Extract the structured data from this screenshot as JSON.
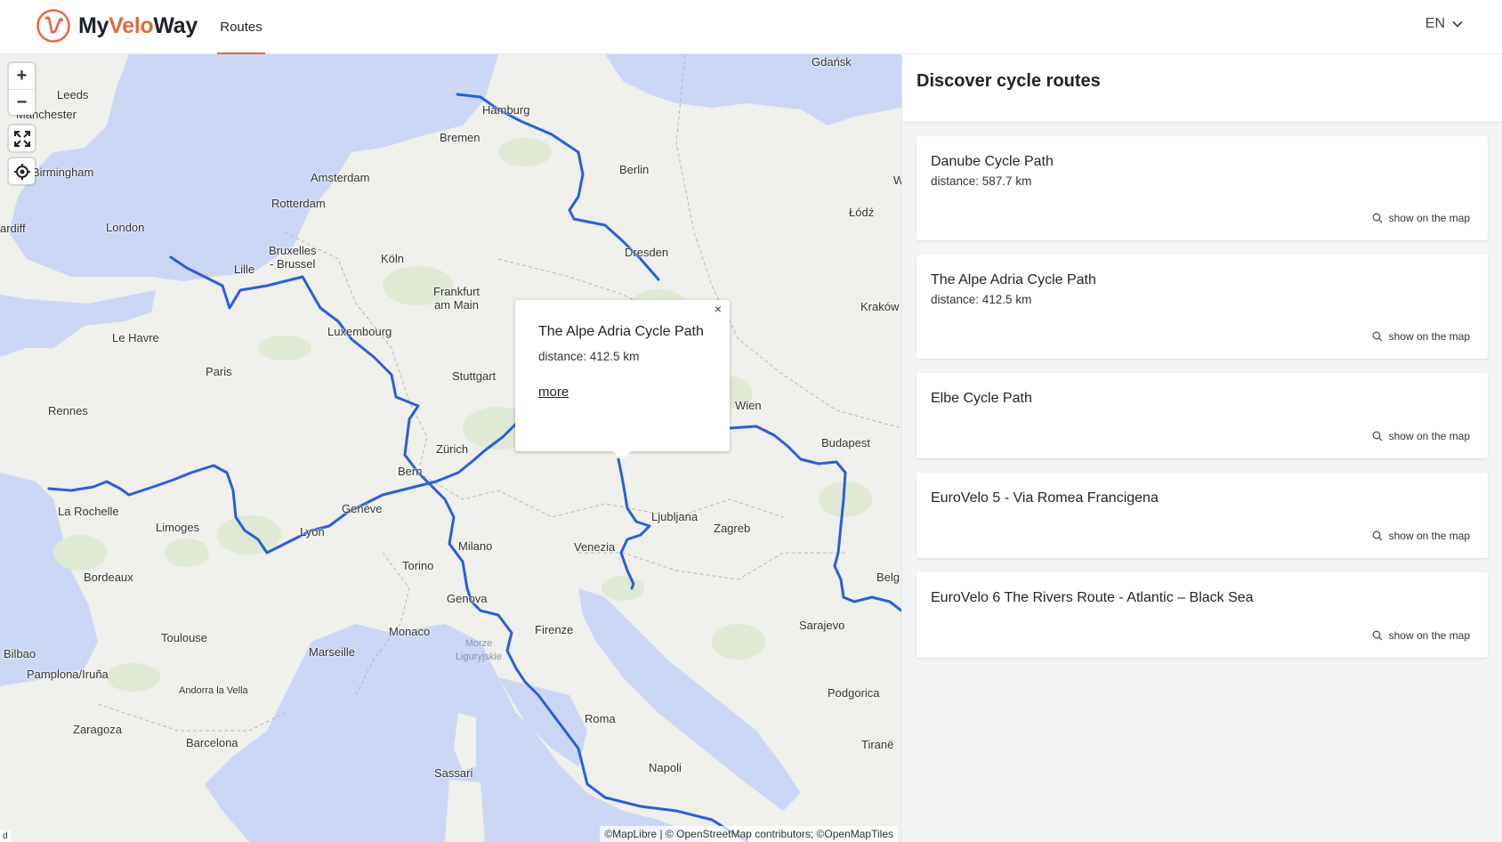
{
  "header": {
    "logo": {
      "part1": "My",
      "part2": "Velo",
      "part3": "Way"
    },
    "nav": [
      {
        "label": "Routes",
        "active": true
      }
    ],
    "language": "EN"
  },
  "colors": {
    "accent": "#e06a3b",
    "route": "#2a5fd6",
    "water": "#cbd7f4"
  },
  "map": {
    "controls": {
      "zoom_in": "+",
      "zoom_out": "−",
      "fullscreen_icon": "fullscreen-icon",
      "locate_icon": "locate-icon"
    },
    "labels": {
      "gdansk": "Gdańsk",
      "leeds": "Leeds",
      "manchester": "Manchester",
      "hamburg": "Hamburg",
      "bremen": "Bremen",
      "birmingham": "Birmingham",
      "amsterdam": "Amsterdam",
      "berlin": "Berlin",
      "rotterdam": "Rotterdam",
      "cardiff": "ardiff",
      "london": "London",
      "lodz": "Łódź",
      "bruxelles": "Bruxelles\n- Brussel",
      "koln": "Köln",
      "dresden": "Dresden",
      "lille": "Lille",
      "frankfurt": "Frankfurt\nam Main",
      "krakow": "Kraków",
      "luxembourg": "Luxembourg",
      "lehavre": "Le Havre",
      "paris": "Paris",
      "stuttgart": "Stuttgart",
      "wien": "Wien",
      "rennes": "Rennes",
      "budapest": "Budapest",
      "zurich": "Zürich",
      "bern": "Bern",
      "geneve": "Genève",
      "larochelle": "La Rochelle",
      "ljubljana": "Ljubljana",
      "limoges": "Limoges",
      "lyon": "Lyon",
      "zagreb": "Zagreb",
      "milano": "Milano",
      "venezia": "Venezia",
      "torino": "Torino",
      "bordeaux": "Bordeaux",
      "belgrade": "Belg",
      "genova": "Genova",
      "firenze": "Firenze",
      "sarajevo": "Sarajevo",
      "monaco": "Monaco",
      "toulouse": "Toulouse",
      "morze": "Morze\nLiguryjskie",
      "bilbao": "Bilbao",
      "marseille": "Marseille",
      "pamplona": "Pamplona/Iruña",
      "andorra": "Andorra la Vella",
      "podgorica": "Podgorica",
      "zaragoza": "Zaragoza",
      "roma": "Roma",
      "barcelona": "Barcelona",
      "tirane": "Tiranë",
      "sassari": "Sassari",
      "napoli": "Napoli",
      "w": "W"
    },
    "popup": {
      "close": "×",
      "title": "The Alpe Adria Cycle Path",
      "distance": "distance: 412.5 km",
      "more": "more"
    },
    "attribution": "©MapLibre | © OpenStreetMap contributors; ©OpenMapTiles",
    "attribution_left": "d"
  },
  "sidebar": {
    "title": "Discover cycle routes",
    "show_label": "show on the map",
    "routes": [
      {
        "name": "Danube Cycle Path",
        "distance": "distance: 587.7 km"
      },
      {
        "name": "The Alpe Adria Cycle Path",
        "distance": "distance: 412.5 km"
      },
      {
        "name": "Elbe Cycle Path",
        "distance": ""
      },
      {
        "name": "EuroVelo 5 - Via Romea Francigena",
        "distance": ""
      },
      {
        "name": "EuroVelo 6 The Rivers Route - Atlantic – Black Sea",
        "distance": ""
      }
    ]
  }
}
